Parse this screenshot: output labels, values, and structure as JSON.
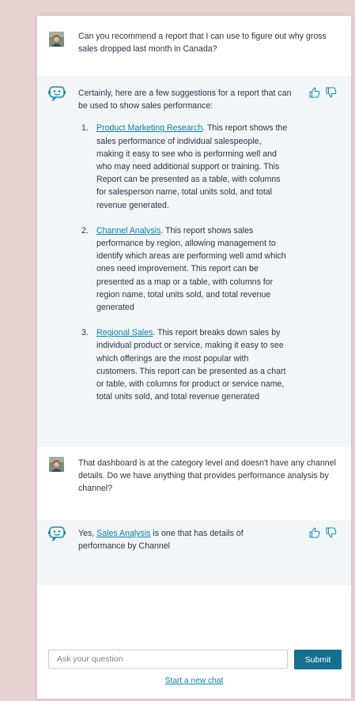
{
  "messages": [
    {
      "role": "user",
      "text": "Can you recommend a report that I can use to figure out why gross sales dropped last month in Canada?"
    },
    {
      "role": "assistant",
      "intro": "Certainly, here are a few suggestions for a report that can be used to show sales performance:",
      "items": [
        {
          "num": "1.",
          "link": "Product Marketing Research",
          "text": ". This report shows the sales performance of individual salespeople, making it easy to see who is performing well and who may need additional support or training. This Report can be presented as a table, with columns for salesperson name, total units sold, and total revenue generated."
        },
        {
          "num": "2.",
          "link": "Channel Analysis",
          "text": ". This report shows sales performance by region, allowing management to identify which areas are performing well amd which ones need improvement. This report can be presented as a map or a table, with columns for region name, total units sold, and total revenue generated"
        },
        {
          "num": "3.",
          "link": "Regional Sales",
          "text": ". This report breaks down sales by individual product or service, making it easy to see which offerings are the most popular with customers. This report can be presented as a chart or table, with columns for product or service name, total units sold, and total revenue generated"
        }
      ]
    },
    {
      "role": "user",
      "text": "That dashboard is at the category level and doesn't have any channel details. Do we have anything that provides performance analysis by channel?"
    },
    {
      "role": "assistant",
      "pre": "Yes, ",
      "link": "Sales Analysis",
      "post": " is one that has details of performance by Channel"
    }
  ],
  "input": {
    "placeholder": "Ask your question",
    "value": ""
  },
  "submit_label": "Submit",
  "new_chat_label": "Start a new chat",
  "icons": {
    "user_avatar": "user-avatar",
    "bot": "chatbot-icon",
    "thumbs_up": "thumbs-up-icon",
    "thumbs_down": "thumbs-down-icon"
  },
  "colors": {
    "accent": "#15708f",
    "link": "#0d7fa3",
    "bot_bg": "#f3f6f8",
    "page_bg": "#e6d4d4"
  }
}
